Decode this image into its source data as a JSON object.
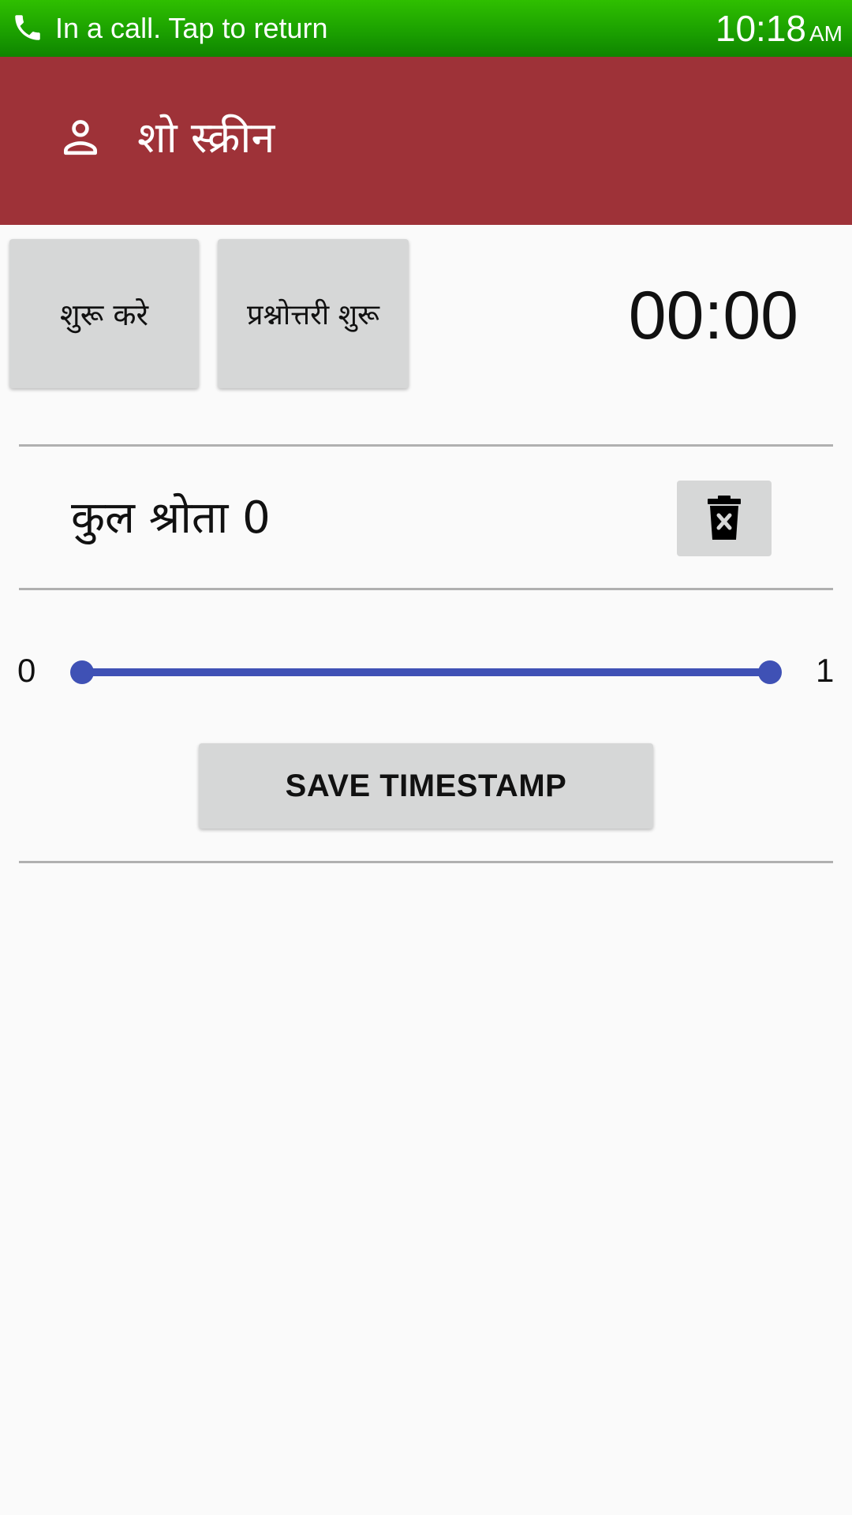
{
  "status_bar": {
    "call_text": "In a call. Tap to return",
    "time": "10:18",
    "ampm": "AM",
    "icon": "phone-icon"
  },
  "app_bar": {
    "title": "शो स्क्रीन",
    "icon": "person-icon",
    "color": "#9e3238"
  },
  "controls": {
    "start_label": "शुरू करे",
    "quiz_label": "प्रश्नोत्तरी शुरू",
    "timer": "00:00"
  },
  "listeners": {
    "label": "कुल श्रोता 0",
    "delete_icon": "delete-icon"
  },
  "range": {
    "min_label": "0",
    "max_label": "1",
    "min_value": 0,
    "max_value": 1,
    "selected_low": 0,
    "selected_high": 1,
    "color": "#3f51b5"
  },
  "save_button": {
    "label": "SAVE TIMESTAMP"
  }
}
